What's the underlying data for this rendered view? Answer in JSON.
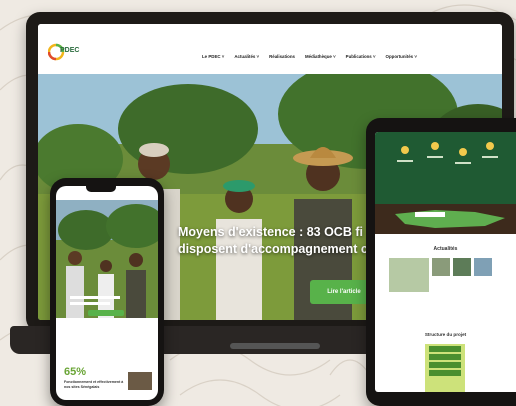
{
  "site": {
    "logo_text": "PDEC"
  },
  "nav": {
    "items": [
      {
        "label": "Le PDEC",
        "chevron": true
      },
      {
        "label": "Actualités",
        "chevron": true
      },
      {
        "label": "Réalisations",
        "chevron": false
      },
      {
        "label": "Médiathèque",
        "chevron": true
      },
      {
        "label": "Publications",
        "chevron": true
      },
      {
        "label": "Opportunités",
        "chevron": true
      }
    ]
  },
  "hero": {
    "title_line1": "Moyens d'existence : 83 OCB fi",
    "title_line2": "disposent d'accompagnement c",
    "button_label": "Lire l'article"
  },
  "tablet": {
    "actualites_heading": "Actualités",
    "structure_heading": "Structure du projet"
  },
  "phone": {
    "stat_value": "65%",
    "stat_label": "Fonctionnement et effectivement à nos sites Sénégalais"
  },
  "colors": {
    "accent_green": "#58b24a",
    "brand_dark_green": "#2a6b3d",
    "device_frame": "#1d1a17"
  }
}
